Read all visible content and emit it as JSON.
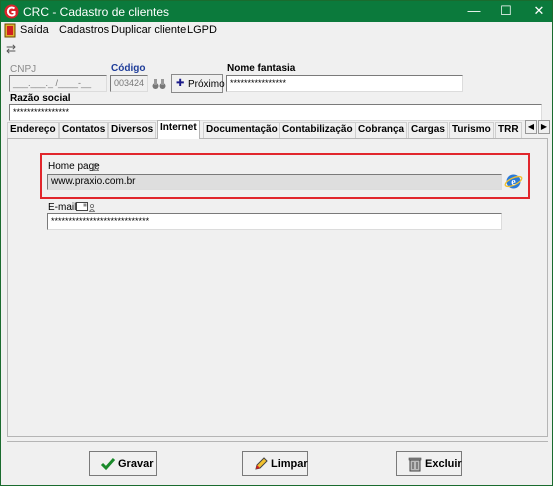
{
  "window": {
    "title": "CRC - Cadastro de clientes",
    "minimize": "—",
    "maximize": "☐",
    "close": "✕"
  },
  "menu": {
    "items": [
      "Saída",
      "Cadastros",
      "Duplicar cliente",
      "LGPD"
    ]
  },
  "header": {
    "cnpj_label": "CNPJ",
    "cnpj_value": "___.___._ /____-__",
    "codigo_label": "Código",
    "codigo_value": "003424",
    "proximo_label": "Próximo",
    "proximo_plus": "✚",
    "nome_fantasia_label": "Nome fantasia",
    "nome_fantasia_value": "****************",
    "razao_social_label": "Razão social",
    "razao_social_value": "****************"
  },
  "tabs": [
    "Endereço",
    "Contatos",
    "Diversos",
    "Internet",
    "Documentação",
    "Contabilização",
    "Cobrança",
    "Cargas",
    "Turismo",
    "TRR"
  ],
  "active_tab": "Internet",
  "internet": {
    "home_page_label": "Home page",
    "home_page_value": "www.praxio.com.br",
    "email_label": "E-mail",
    "email_value": "****************************"
  },
  "actions": {
    "gravar": "Gravar",
    "limpar": "Limpar",
    "excluir": "Excluir"
  },
  "colors": {
    "titlebar": "#0b7a3c",
    "highlight": "#e1262c",
    "codigo_label": "#1f3d99"
  }
}
